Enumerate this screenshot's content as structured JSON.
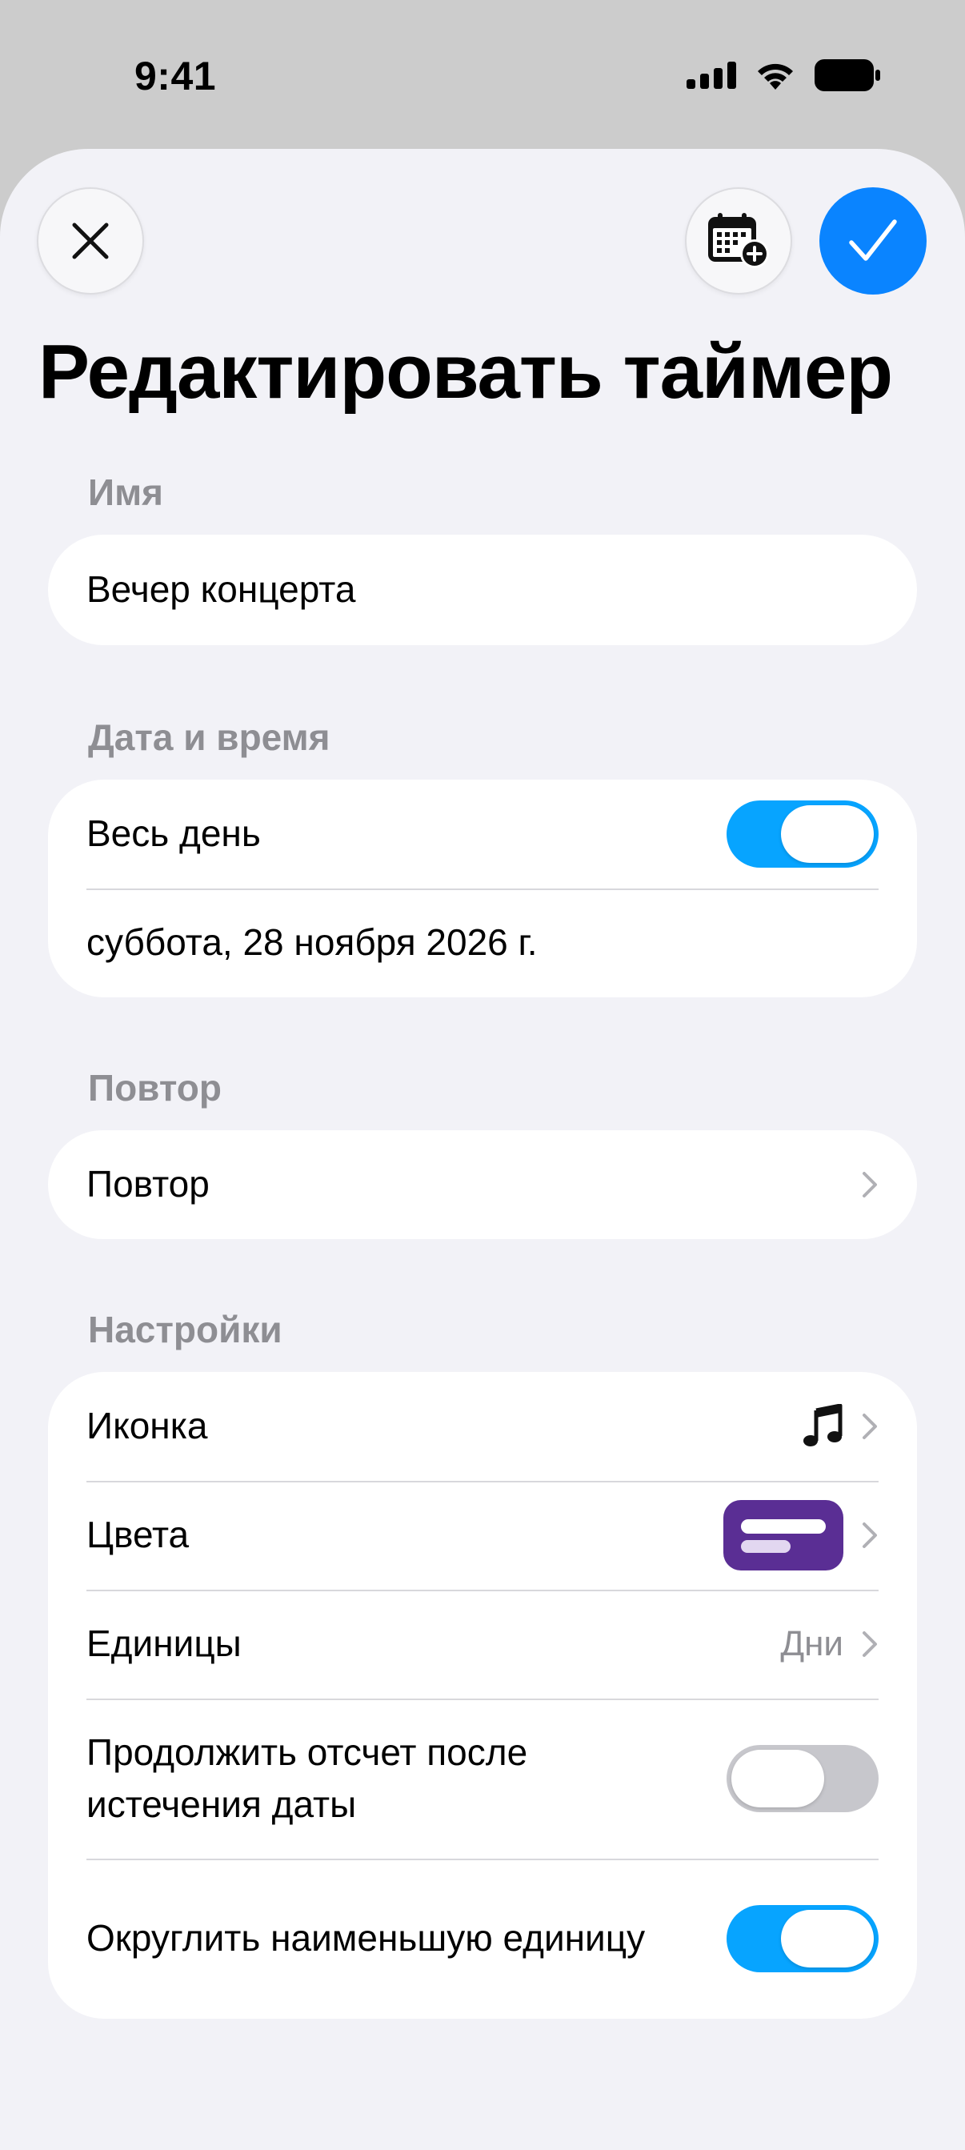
{
  "status_bar": {
    "time": "9:41",
    "icons": [
      "cellular-signal-icon",
      "wifi-icon",
      "battery-icon"
    ]
  },
  "toolbar": {
    "close_icon": "close-icon",
    "calendar_icon": "calendar-add-icon",
    "confirm_icon": "checkmark-icon",
    "accent_color": "#0a84ff"
  },
  "title": "Редактировать таймер",
  "sections": {
    "name": {
      "label": "Имя",
      "value": "Вечер концерта"
    },
    "datetime": {
      "label": "Дата и время",
      "all_day_label": "Весь день",
      "all_day_on": true,
      "date_value": "суббота, 28 ноября 2026 г."
    },
    "repeat": {
      "label": "Повтор",
      "row_label": "Повтор"
    },
    "settings": {
      "label": "Настройки",
      "icon_label": "Иконка",
      "icon_value": "music-note-icon",
      "colors_label": "Цвета",
      "colors_value": "#5a2e94",
      "units_label": "Единицы",
      "units_value": "Дни",
      "continue_label": "Продолжить отсчет после истечения даты",
      "continue_on": false,
      "round_label": "Округлить наименьшую единицу",
      "round_on": true
    }
  },
  "colors": {
    "toggle_on": "#07a4ff",
    "toggle_off": "#c7c7cc",
    "background": "#f2f2f7",
    "secondary_text": "#8e8e93"
  }
}
